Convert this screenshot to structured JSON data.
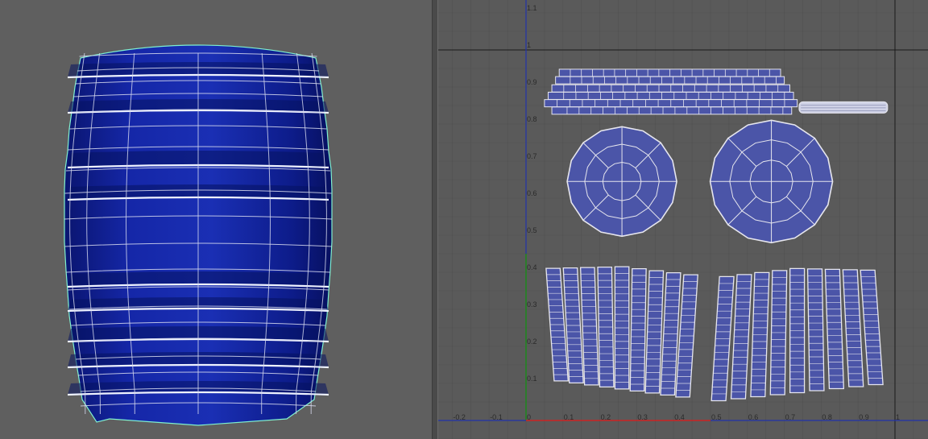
{
  "colors": {
    "viewport_bg": "#5f5f5f",
    "uv_bg": "#5a5a5a",
    "barrel_fill": "#0d1f8c",
    "barrel_band": "#061260",
    "wire_outer": "#7ff0d0",
    "wire_inner": "#d7dbef",
    "uv_shell_fill": "#4b55a8",
    "uv_shell_edge": "#e6e6ee",
    "grid_line": "#515151",
    "axis_u": "#cc2222",
    "axis_v": "#1a8a1a",
    "axis_blue": "#2233aa"
  },
  "uv_editor": {
    "v_axis_labels": [
      "1.1",
      "1",
      "0.9",
      "0.8",
      "0.7",
      "0.6",
      "0.5",
      "0.4",
      "0.3",
      "0.2",
      "0.1"
    ],
    "u_axis_labels": [
      "-0.2",
      "-0.1",
      "0",
      "0.1",
      "0.2",
      "0.3",
      "0.4",
      "0.5",
      "0.6",
      "0.7",
      "0.8",
      "0.9",
      "1"
    ]
  },
  "viewport_3d": {
    "object": "barrel-mesh"
  }
}
